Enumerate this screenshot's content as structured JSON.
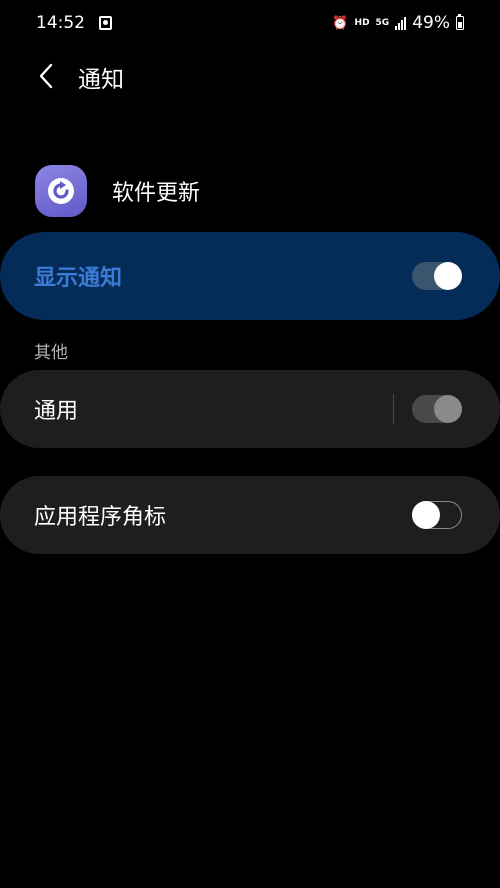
{
  "status_bar": {
    "time": "14:52",
    "hd": "HD",
    "network": "5G",
    "battery": "49%"
  },
  "header": {
    "title": "通知"
  },
  "app": {
    "name": "软件更新"
  },
  "main_toggle": {
    "label": "显示通知",
    "state": true
  },
  "section": {
    "title": "其他"
  },
  "settings": [
    {
      "label": "通用",
      "state": true
    },
    {
      "label": "应用程序角标",
      "state": false
    }
  ],
  "colors": {
    "background": "#000000",
    "accent_bg": "#052c58",
    "accent_text": "#3a7bd5",
    "card_bg": "#1e1e1e",
    "app_icon": "#7a72d8"
  },
  "icons": {
    "back": "chevron-left-icon",
    "app": "refresh-icon",
    "alarm": "alarm-icon",
    "notification": "notification-box-icon",
    "signal": "signal-icon",
    "battery": "battery-icon"
  }
}
